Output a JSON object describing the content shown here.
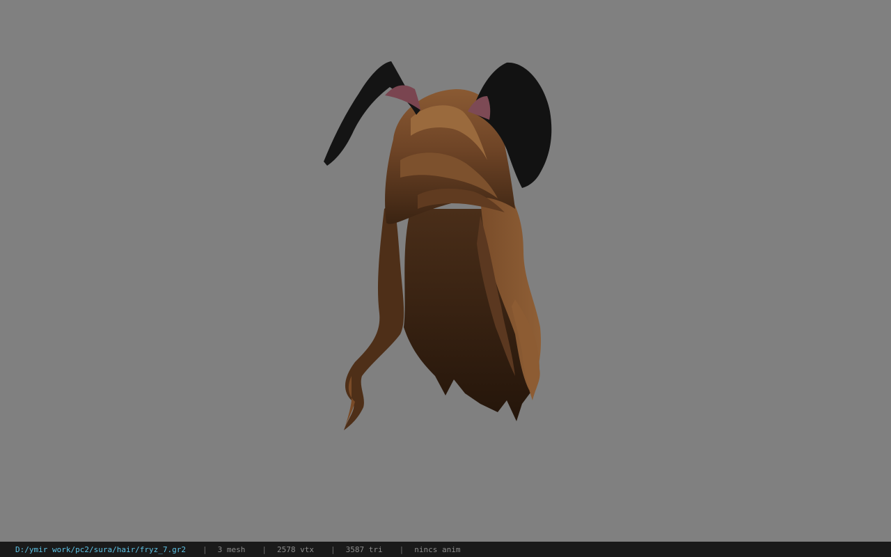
{
  "viewport": {
    "background_color": "#808080",
    "model": "hair-with-bunny-ears"
  },
  "status_bar": {
    "file_path": "D:/ymir work/pc2/sura/hair/fryz_7.gr2",
    "separator": "|",
    "mesh_count": "3 mesh",
    "vertex_count": "2578 vtx",
    "triangle_count": "3587 tri",
    "animation": "nincs anim"
  },
  "colors": {
    "status_bg": "#1a1a1a",
    "path_color": "#5ec3e6",
    "stat_color": "#8c8c8c"
  }
}
